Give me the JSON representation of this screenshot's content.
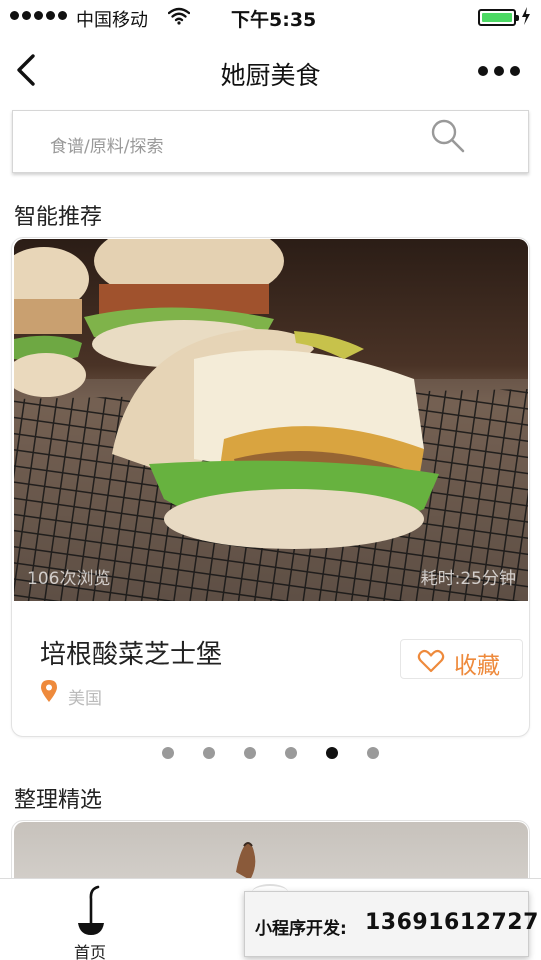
{
  "status_bar": {
    "carrier": "中国移动",
    "time": "下午5:35",
    "signal_icon": "signal-dots-icon",
    "wifi_icon": "wifi-icon",
    "battery_icon": "battery-icon",
    "battery_level": 0.9,
    "battery_color": "#4cd964",
    "charge_icon": "charging-bolt-icon"
  },
  "nav": {
    "title": "她厨美食",
    "back_icon": "chevron-left-icon",
    "more_icon": "more-dots-icon"
  },
  "search": {
    "placeholder": "食谱/原料/探索",
    "icon": "search-icon"
  },
  "recommend": {
    "title": "智能推荐",
    "card": {
      "views": "106次浏览",
      "cook_time": "耗时:25分钟",
      "name": "培根酸菜芝士堡",
      "origin": "美国",
      "favorite_label": "收藏",
      "accent_color": "#ee8a3c"
    },
    "pagination": {
      "total": 6,
      "active_index": 4
    }
  },
  "curated": {
    "title": "整理精选"
  },
  "tab_bar": {
    "home_label": "首页",
    "home_icon": "ladle-icon"
  },
  "promo": {
    "label": "小程序开发:",
    "phone": "13691612727"
  }
}
